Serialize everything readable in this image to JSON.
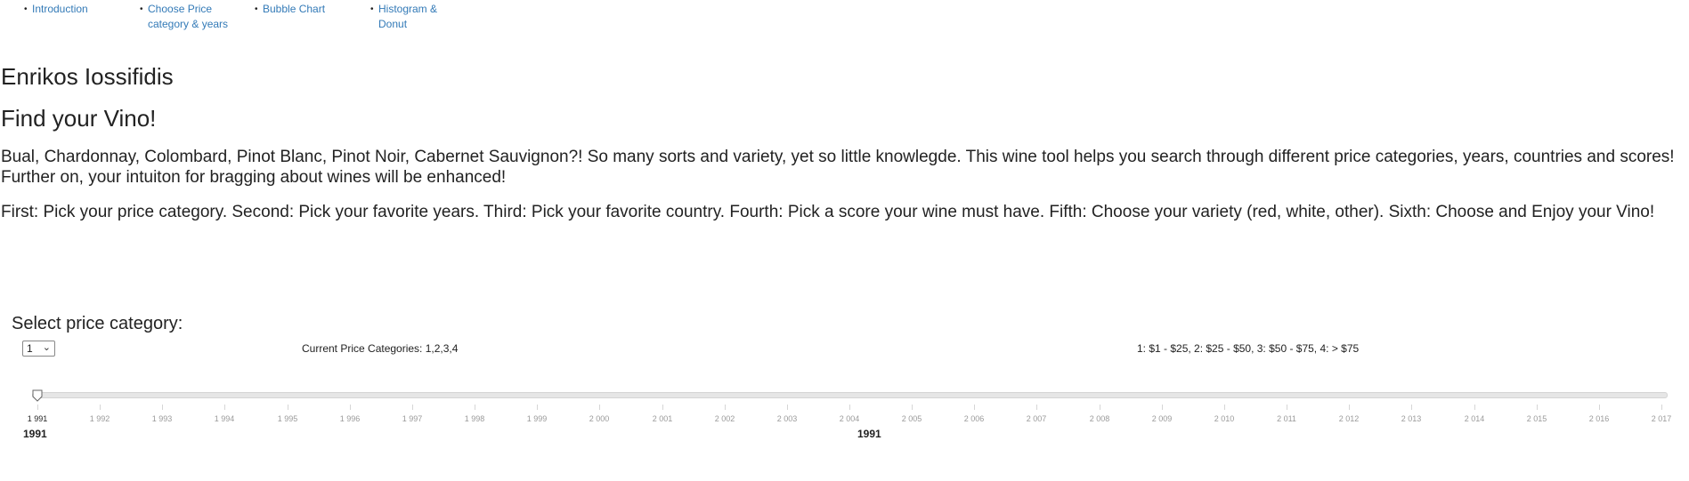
{
  "nav": {
    "items": [
      {
        "label_lines": [
          "Introduction"
        ]
      },
      {
        "label_lines": [
          "Choose Price",
          "category & years"
        ]
      },
      {
        "label_lines": [
          "Bubble Chart"
        ]
      },
      {
        "label_lines": [
          "Histogram &",
          "Donut"
        ]
      }
    ]
  },
  "header": {
    "author": "Enrikos Iossifidis",
    "title": "Find your Vino!"
  },
  "intro": {
    "paragraph1": "Bual, Chardonnay, Colombard, Pinot Blanc, Pinot Noir, Cabernet Sauvignon?! So many sorts and variety, yet so little knowlegde. This wine tool helps you search through different price categories, years, countries and scores! Further on, your intuiton for bragging about wines will be enhanced!",
    "paragraph2": "First: Pick your price category. Second: Pick your favorite years. Third: Pick your favorite country. Fourth: Pick a score your wine must have. Fifth: Choose your variety (red, white, other). Sixth: Choose and Enjoy your Vino!"
  },
  "price_selector": {
    "label": "Select price category:",
    "selected": "1",
    "current_text": "Current Price Categories: 1,2,3,4",
    "legend_text": "1: $1 - $25, 2: $25 - $50, 3: $50 - $75, 4: > $75"
  },
  "year_slider": {
    "ticks": [
      "1 991",
      "1 992",
      "1 993",
      "1 994",
      "1 995",
      "1 996",
      "1 997",
      "1 998",
      "1 999",
      "2 000",
      "2 001",
      "2 002",
      "2 003",
      "2 004",
      "2 005",
      "2 006",
      "2 007",
      "2 008",
      "2 009",
      "2 010",
      "2 011",
      "2 012",
      "2 013",
      "2 014",
      "2 015",
      "2 016",
      "2 017"
    ],
    "selected_value": 1991,
    "value_left": "1991",
    "value_center": "1991"
  },
  "colors": {
    "link": "#337ab7",
    "text": "#222222",
    "slider_track": "#e6e6e6",
    "tick_label": "#9a9a9a"
  }
}
